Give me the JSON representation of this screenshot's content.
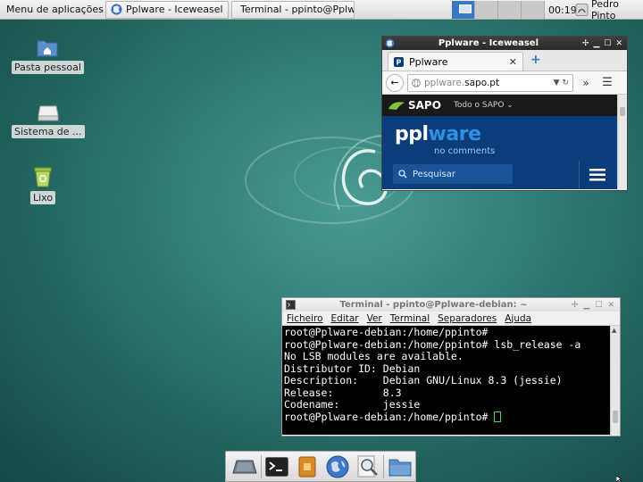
{
  "top_panel": {
    "app_menu_label": "Menu de aplicações",
    "tasks": [
      {
        "label": "Pplware - Iceweasel"
      },
      {
        "label": "Terminal - ppinto@Pplw..."
      }
    ],
    "clock": "00:19",
    "user_name": "Pedro Pinto"
  },
  "desktop_icons": [
    {
      "label": "Pasta pessoal",
      "icon": "home-folder-icon"
    },
    {
      "label": "Sistema de ...",
      "icon": "drive-icon"
    },
    {
      "label": "Lixo",
      "icon": "trash-icon"
    }
  ],
  "browser": {
    "window_title": "Pplware - Iceweasel",
    "tab_label": "Pplware",
    "url_prefix": "pplware.",
    "url_domain": "sapo.pt",
    "sapo_label": "SAPO",
    "sapo_menu": "Todo o SAPO ⌄",
    "logo_ppl": "ppl",
    "logo_ware": "ware",
    "tagline": "no comments",
    "search_placeholder": "Pesquisar"
  },
  "terminal": {
    "window_title": "Terminal - ppinto@Pplware-debian: ~",
    "menu": [
      "Ficheiro",
      "Editar",
      "Ver",
      "Terminal",
      "Separadores",
      "Ajuda"
    ],
    "lines": [
      "root@Pplware-debian:/home/ppinto#",
      "root@Pplware-debian:/home/ppinto# lsb_release -a",
      "No LSB modules are available.",
      "Distributor ID:\tDebian",
      "Description:\tDebian GNU/Linux 8.3 (jessie)",
      "Release:\t8.3",
      "Codename:\tjessie"
    ],
    "prompt": "root@Pplware-debian:/home/ppinto# "
  },
  "colors": {
    "desktop_teal": "#327e77",
    "workspace_active": "#3b78c4",
    "pplware_blue": "#0b3d7a",
    "terminal_cursor": "#4fd34f"
  }
}
